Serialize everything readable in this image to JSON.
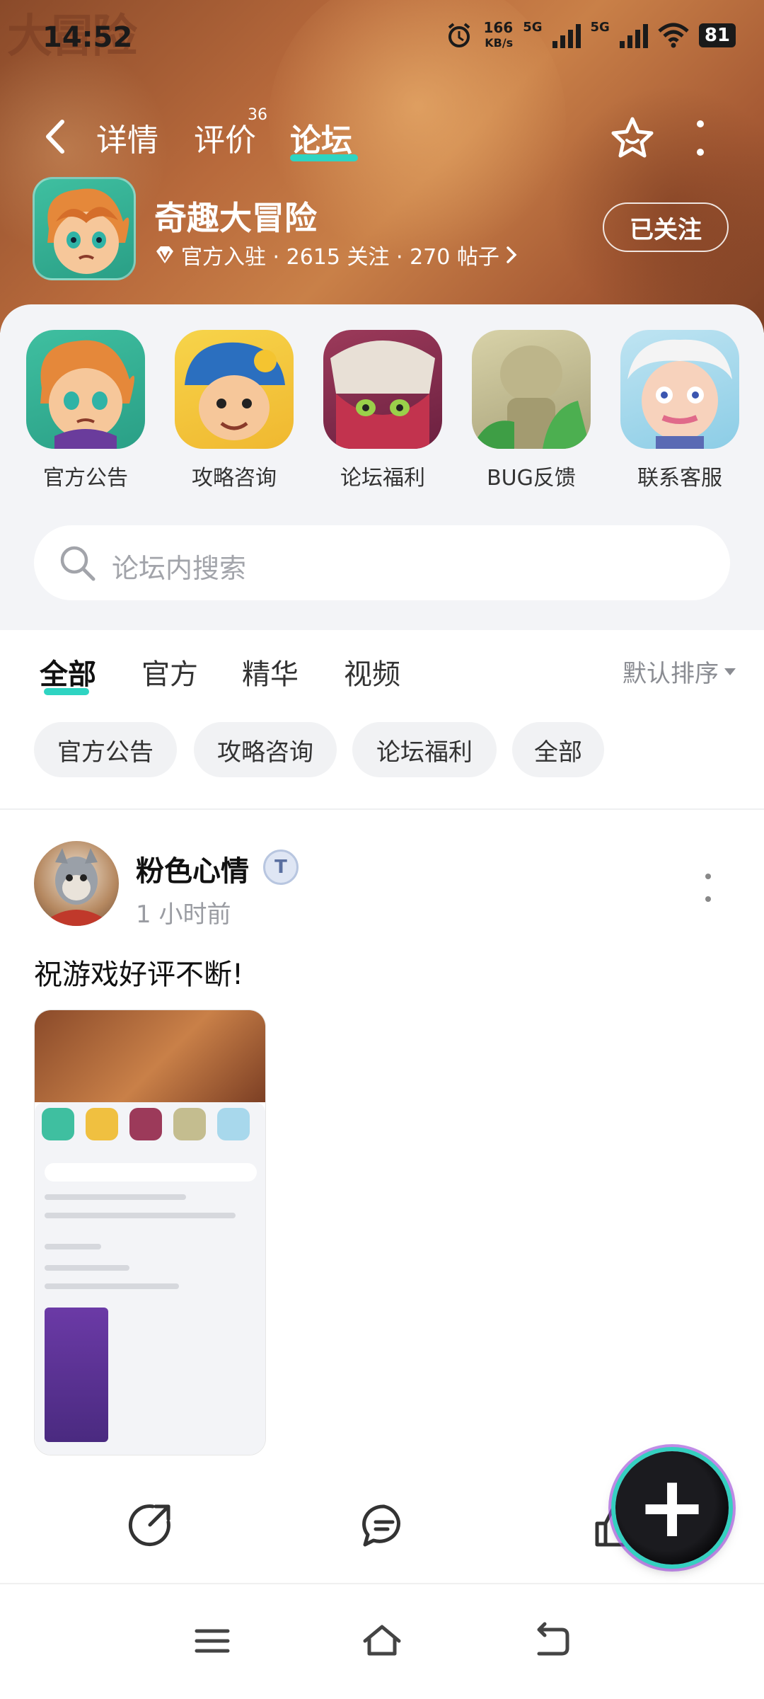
{
  "status_bar": {
    "time": "14:52",
    "net_speed_value": "166",
    "net_speed_unit": "KB/s",
    "sim1_type": "5G",
    "sim2_type": "5G",
    "battery": "81"
  },
  "banner": {
    "watermark_text": "大冒险"
  },
  "top_nav": {
    "tabs": [
      {
        "label": "详情"
      },
      {
        "label": "评价",
        "badge": "36"
      },
      {
        "label": "论坛"
      }
    ],
    "active_tab": "论坛"
  },
  "game": {
    "title": "奇趣大冒险",
    "meta": "官方入驻 · 2615 关注 · 270 帖子",
    "follow_label": "已关注"
  },
  "categories": [
    {
      "label": "官方公告"
    },
    {
      "label": "攻略咨询"
    },
    {
      "label": "论坛福利"
    },
    {
      "label": "BUG反馈"
    },
    {
      "label": "联系客服"
    }
  ],
  "search": {
    "placeholder": "论坛内搜索"
  },
  "filter_tabs": [
    {
      "label": "全部"
    },
    {
      "label": "官方"
    },
    {
      "label": "精华"
    },
    {
      "label": "视频"
    }
  ],
  "sort_label": "默认排序",
  "chips": [
    {
      "label": "官方公告"
    },
    {
      "label": "攻略咨询"
    },
    {
      "label": "论坛福利"
    },
    {
      "label": "全部"
    }
  ],
  "post": {
    "username": "粉色心情",
    "user_badge": "T",
    "time": "1 小时前",
    "text": "祝游戏好评不断!"
  },
  "colors": {
    "accent": "#2fd4c2",
    "banner": "#b86a3c",
    "card_bg": "#f3f4f7"
  }
}
